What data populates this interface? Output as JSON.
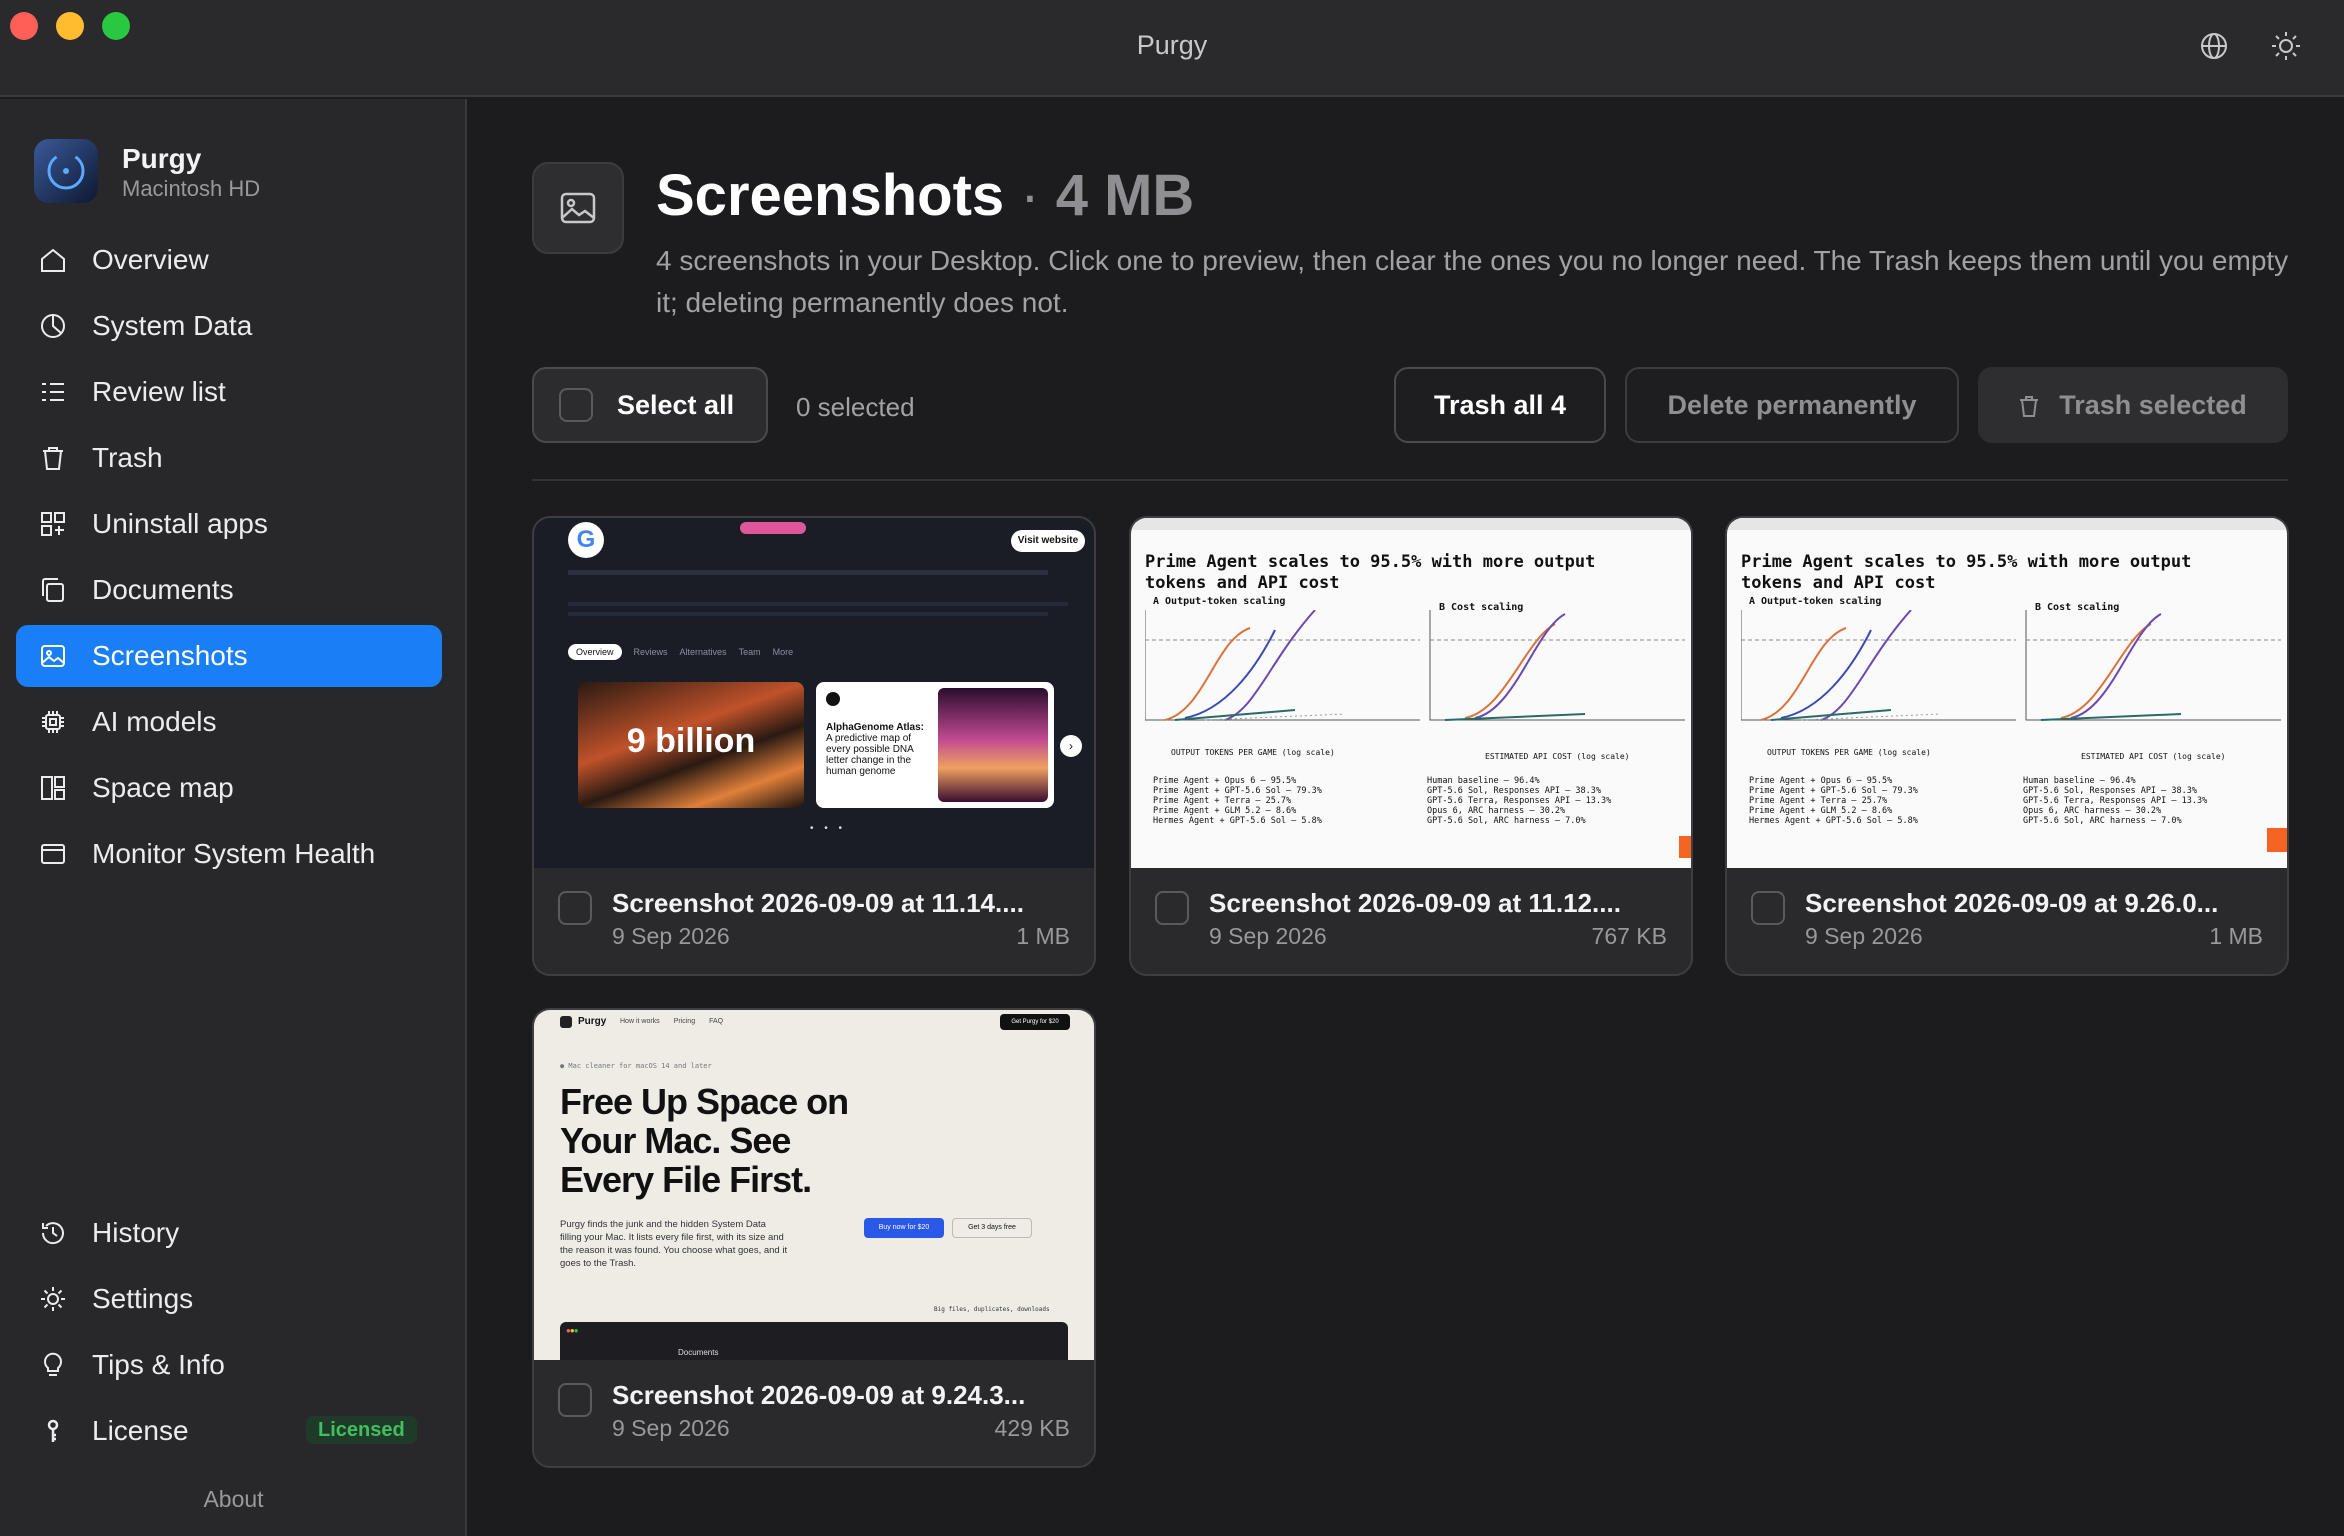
{
  "window": {
    "title": "Purgy"
  },
  "sidebar": {
    "brand": {
      "name": "Purgy",
      "subtitle": "Macintosh HD"
    },
    "items": [
      {
        "label": "Overview",
        "icon": "home-icon"
      },
      {
        "label": "System Data",
        "icon": "pie-icon"
      },
      {
        "label": "Review list",
        "icon": "checklist-icon"
      },
      {
        "label": "Trash",
        "icon": "trash-icon"
      },
      {
        "label": "Uninstall apps",
        "icon": "apps-icon"
      },
      {
        "label": "Documents",
        "icon": "documents-icon"
      },
      {
        "label": "Screenshots",
        "icon": "image-icon",
        "active": true
      },
      {
        "label": "AI models",
        "icon": "chip-icon"
      },
      {
        "label": "Space map",
        "icon": "space-map-icon"
      },
      {
        "label": "Monitor System Health",
        "icon": "monitor-icon"
      }
    ],
    "bottom_items": [
      {
        "label": "History",
        "icon": "history-icon"
      },
      {
        "label": "Settings",
        "icon": "gear-icon"
      },
      {
        "label": "Tips & Info",
        "icon": "lightbulb-icon"
      },
      {
        "label": "License",
        "icon": "key-icon",
        "badge": "Licensed"
      }
    ],
    "about": "About"
  },
  "header": {
    "title": "Screenshots",
    "separator": "·",
    "size": "4 MB",
    "description": "4 screenshots in your Desktop. Click one to preview, then clear the ones you no longer need. The Trash keeps them until you empty it; deleting permanently does not."
  },
  "toolbar": {
    "select_all": "Select all",
    "selected_count": "0 selected",
    "trash_all": "Trash all 4",
    "delete_permanently": "Delete permanently",
    "trash_selected": "Trash selected"
  },
  "screenshots": [
    {
      "name": "Screenshot 2026-09-09 at 11.14....",
      "date": "9 Sep 2026",
      "size": "1 MB"
    },
    {
      "name": "Screenshot 2026-09-09 at 11.12....",
      "date": "9 Sep 2026",
      "size": "767 KB"
    },
    {
      "name": "Screenshot 2026-09-09 at 9.26.0...",
      "date": "9 Sep 2026",
      "size": "1 MB"
    },
    {
      "name": "Screenshot 2026-09-09 at 9.24.3...",
      "date": "9 Sep 2026",
      "size": "429 KB"
    }
  ],
  "thumbnails": {
    "google": {
      "headline": "9 billion",
      "card_title": "AlphaGenome Atlas:",
      "card_text": "A predictive map of every possible DNA letter change in the human genome",
      "tabs": [
        "Overview",
        "Reviews",
        "Alternatives",
        "Team",
        "More"
      ],
      "button": "Visit website"
    },
    "chart": {
      "title": "Prime Agent scales to 95.5% with more output tokens and API cost",
      "panel_a": "A Output-token scaling",
      "panel_b": "B Cost scaling",
      "legend": [
        "Prime Agent + Opus 6 – 95.5%",
        "Prime Agent + GPT-5.6 Sol – 79.3%",
        "Prime Agent + Terra – 25.7%",
        "Prime Agent + GLM 5.2 – 8.6%",
        "Hermes Agent + GPT-5.6 Sol – 5.8%"
      ],
      "refs": [
        "Human baseline – 96.4%",
        "GPT-5.6 Sol, Responses API – 38.3%",
        "GPT-5.6 Terra, Responses API – 13.3%",
        "Opus 6, ARC harness – 30.2%",
        "GPT-5.6 Sol, ARC harness – 7.0%"
      ],
      "xlabel_a": "OUTPUT TOKENS PER GAME (log scale)",
      "xlabel_b": "ESTIMATED API COST (log scale)"
    },
    "purgy": {
      "logo": "Purgy",
      "nav": [
        "How it works",
        "Pricing",
        "FAQ"
      ],
      "cta": "Get Purgy for $20",
      "eyebrow": "● Mac cleaner for macOS 14 and later",
      "headline": "Free Up Space on Your Mac. See Every File First.",
      "body": "Purgy finds the junk and the hidden System Data filling your Mac. It lists every file first, with its size and the reason it was found. You choose what goes, and it goes to the Trash.",
      "buy": "Buy now for $20",
      "trial": "Get 3 days free",
      "tags": "Big files, duplicates, downloads",
      "window_label": "Documents"
    }
  },
  "colors": {
    "accent": "#1a7ff5",
    "licensed": "#3fbf5e",
    "bg": "#1c1c1e",
    "sidebar": "#28282a"
  }
}
